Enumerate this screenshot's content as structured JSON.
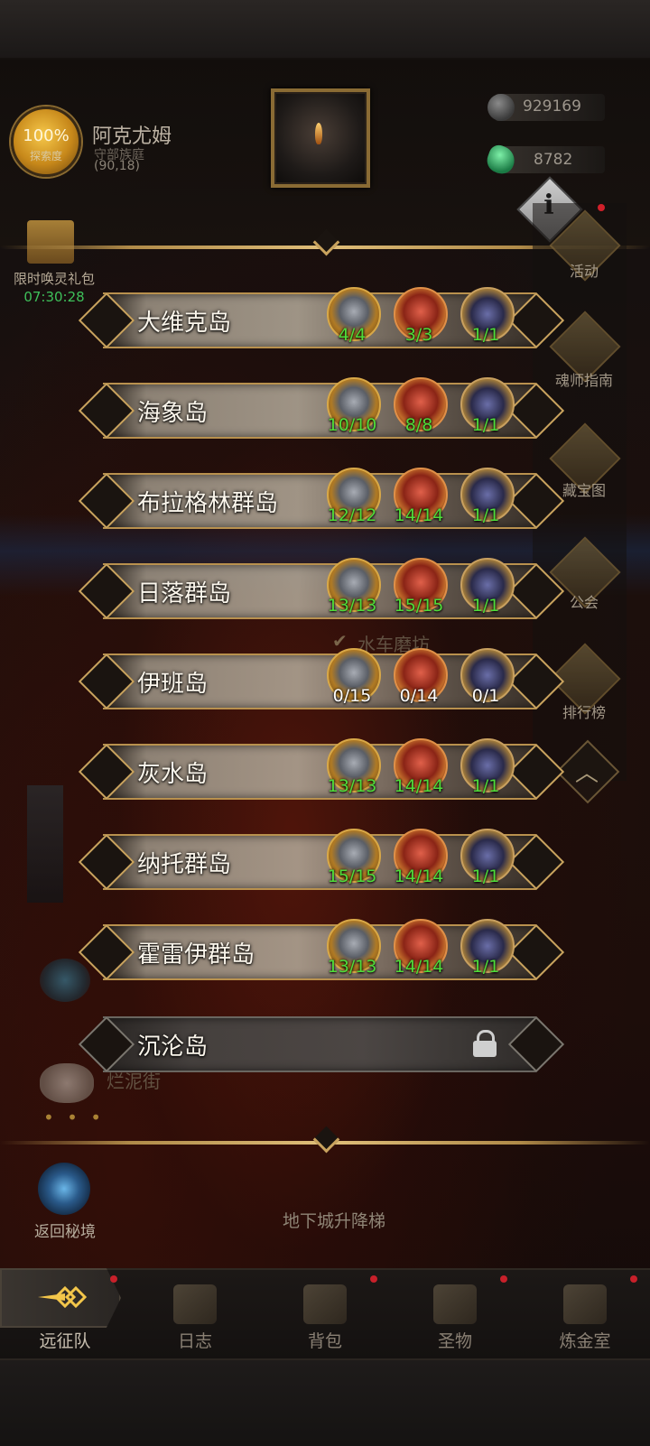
{
  "header": {
    "exploration_percent": "100%",
    "exploration_label": "探索度",
    "location_name": "阿克尤姆",
    "location_sub": "守部族庭",
    "location_coords": "(90,18)",
    "resource_ore": "929169",
    "resource_gem": "8782"
  },
  "gift_pack": {
    "label": "限时唤灵礼包",
    "timer": "07:30:28"
  },
  "side_menu": [
    {
      "label": "活动",
      "icon": "gift-box-icon",
      "has_dot": true
    },
    {
      "label": "魂师指南",
      "icon": "compass-icon",
      "has_dot": false
    },
    {
      "label": "藏宝图",
      "icon": "treasure-map-icon",
      "has_dot": false
    },
    {
      "label": "公会",
      "icon": "guild-emblem-icon",
      "has_dot": false
    },
    {
      "label": "排行榜",
      "icon": "trophy-icon",
      "has_dot": false
    }
  ],
  "islands": [
    {
      "name": "大维克岛",
      "locked": false,
      "chest": "4/4",
      "relic": "3/3",
      "boss": "1/1",
      "complete": true
    },
    {
      "name": "海象岛",
      "locked": false,
      "chest": "10/10",
      "relic": "8/8",
      "boss": "1/1",
      "complete": true
    },
    {
      "name": "布拉格林群岛",
      "locked": false,
      "chest": "12/12",
      "relic": "14/14",
      "boss": "1/1",
      "complete": true
    },
    {
      "name": "日落群岛",
      "locked": false,
      "chest": "13/13",
      "relic": "15/15",
      "boss": "1/1",
      "complete": true
    },
    {
      "name": "伊班岛",
      "locked": false,
      "chest": "0/15",
      "relic": "0/14",
      "boss": "0/1",
      "complete": false
    },
    {
      "name": "灰水岛",
      "locked": false,
      "chest": "13/13",
      "relic": "14/14",
      "boss": "1/1",
      "complete": true
    },
    {
      "name": "纳托群岛",
      "locked": false,
      "chest": "15/15",
      "relic": "14/14",
      "boss": "1/1",
      "complete": true
    },
    {
      "name": "霍雷伊群岛",
      "locked": false,
      "chest": "13/13",
      "relic": "14/14",
      "boss": "1/1",
      "complete": true
    },
    {
      "name": "沉沦岛",
      "locked": true
    }
  ],
  "map_labels": {
    "watermill": "水车磨坊",
    "mud_street": "烂泥街",
    "elevator": "地下城升降梯"
  },
  "return_portal": {
    "label": "返回秘境"
  },
  "bottom_nav": [
    {
      "label": "远征队",
      "active": true,
      "has_dot": true
    },
    {
      "label": "日志",
      "active": false,
      "has_dot": false
    },
    {
      "label": "背包",
      "active": false,
      "has_dot": true
    },
    {
      "label": "圣物",
      "active": false,
      "has_dot": true
    },
    {
      "label": "炼金室",
      "active": false,
      "has_dot": true
    }
  ],
  "colors": {
    "complete": "#4fdc3a",
    "incomplete": "#ffffff",
    "gold_trim": "#c9a35e"
  }
}
